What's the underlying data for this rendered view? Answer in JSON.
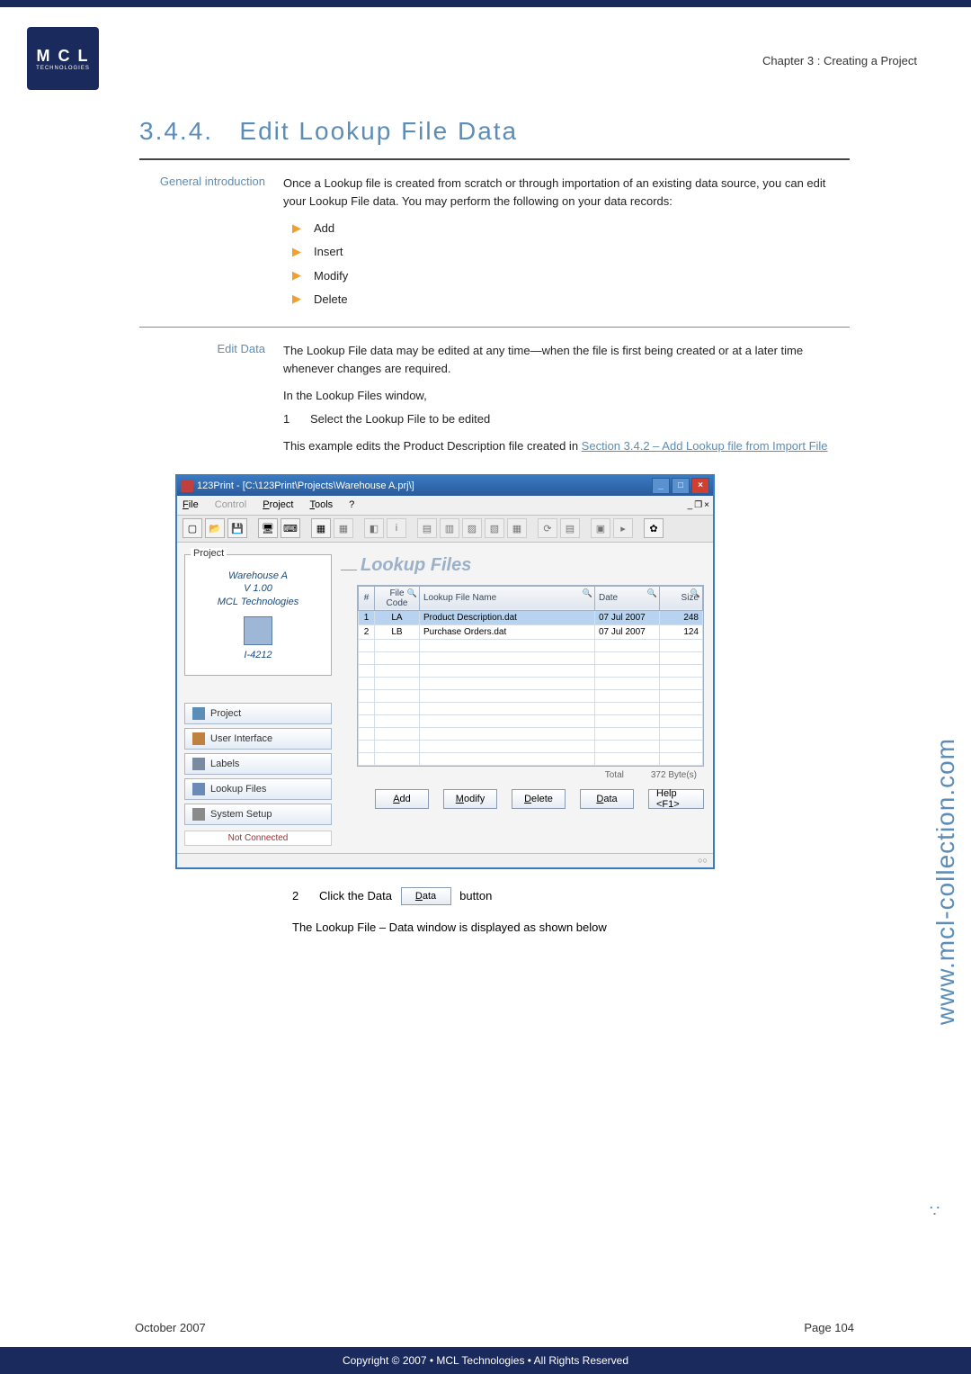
{
  "chapter_header": "Chapter 3 : Creating a Project",
  "logo": {
    "letters": "M C L",
    "sub": "TECHNOLOGIES"
  },
  "section_number": "3.4.4.",
  "section_title": "Edit Lookup File Data",
  "general_intro": {
    "label": "General introduction",
    "body": "Once a Lookup file is created from scratch or through importation of an existing data source, you can edit your Lookup File data. You may perform the following on your data records:",
    "bullets": [
      "Add",
      "Insert",
      "Modify",
      "Delete"
    ]
  },
  "edit_data": {
    "label": "Edit Data",
    "body1": "The Lookup File data may be edited at any time—when the file is first being created or at a later time whenever changes are required.",
    "line2": "In the Lookup Files window,",
    "step1_text": "Select the Lookup File to be edited",
    "body3_pre": "This example edits the Product Description file created in ",
    "body3_link": "Section 3.4.2 – Add Lookup file from Import File"
  },
  "screenshot": {
    "title": "123Print - [C:\\123Print\\Projects\\Warehouse A.prj\\]",
    "menubar": [
      "File",
      "Control",
      "Project",
      "Tools",
      "?"
    ],
    "menubar_disabled_index": 1,
    "project_panel": {
      "legend": "Project",
      "name": "Warehouse A",
      "version": "V 1.00",
      "company": "MCL Technologies",
      "model": "I-4212"
    },
    "nav": [
      "Project",
      "User Interface",
      "Labels",
      "Lookup Files",
      "System Setup"
    ],
    "status_left": "Not Connected",
    "panel_title": "Lookup Files",
    "table": {
      "headers": [
        "#",
        "File Code",
        "Lookup File Name",
        "Date",
        "Size"
      ],
      "rows": [
        {
          "n": "1",
          "code": "LA",
          "name": "Product Description.dat",
          "date": "07 Jul 2007",
          "size": "248",
          "selected": true
        },
        {
          "n": "2",
          "code": "LB",
          "name": "Purchase Orders.dat",
          "date": "07 Jul 2007",
          "size": "124",
          "selected": false
        }
      ],
      "total_label": "Total",
      "total_value": "372 Byte(s)"
    },
    "actions": [
      "Add",
      "Modify",
      "Delete",
      "Data",
      "Help <F1>"
    ],
    "status_right": "○○"
  },
  "step2": {
    "num": "2",
    "pre": "Click the Data ",
    "btn": "Data",
    "post": " button"
  },
  "followup": "The Lookup File – Data window is displayed as shown below",
  "side_url": "www.mcl-collection.com",
  "side_dots": "∴",
  "footer_date": "October 2007",
  "footer_page": "Page 104",
  "copyright": "Copyright © 2007 • MCL Technologies • All Rights Reserved"
}
